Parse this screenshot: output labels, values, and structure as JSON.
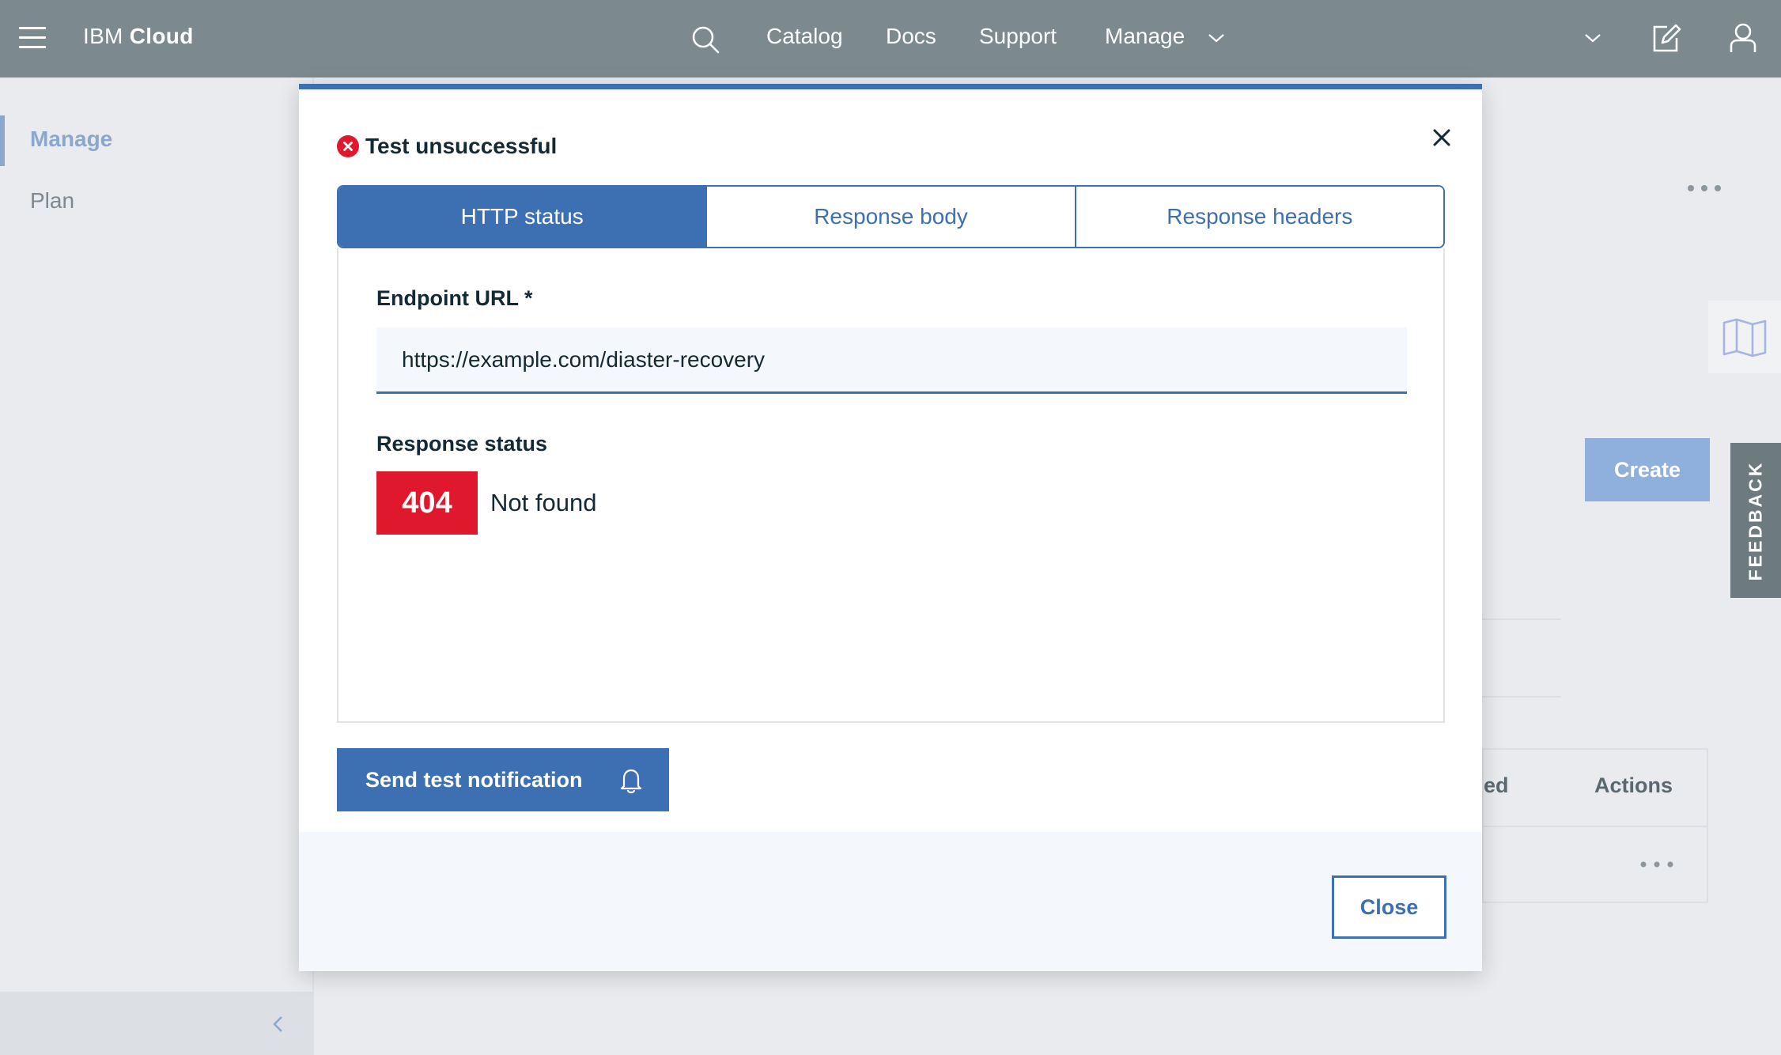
{
  "header": {
    "brand_prefix": "IBM",
    "brand_name": "Cloud",
    "nav": {
      "catalog": "Catalog",
      "docs": "Docs",
      "support": "Support",
      "manage": "Manage"
    },
    "icons": [
      "menu-icon",
      "search-icon",
      "chevron-down-icon",
      "edit-icon",
      "user-icon"
    ]
  },
  "sidebar": {
    "items": [
      {
        "label": "Manage",
        "active": true
      },
      {
        "label": "Plan",
        "active": false
      }
    ]
  },
  "background": {
    "create_label": "Create",
    "feedback_label": "FEEDBACK",
    "table_header_fragment": "ed",
    "table_header_actions": "Actions"
  },
  "modal": {
    "status_title": "Test unsuccessful",
    "tabs": [
      {
        "label": "HTTP status",
        "selected": true
      },
      {
        "label": "Response body",
        "selected": false
      },
      {
        "label": "Response headers",
        "selected": false
      }
    ],
    "endpoint_label": "Endpoint URL *",
    "endpoint_value": "https://example.com/diaster-recovery",
    "response_label": "Response status",
    "response_code": "404",
    "response_text": "Not found",
    "send_label": "Send test notification",
    "close_label": "Close"
  },
  "colors": {
    "header_bg": "#7c8a8f",
    "primary": "#3d70b2",
    "error": "#e0182d",
    "create_disabled": "#8fb0dc"
  }
}
